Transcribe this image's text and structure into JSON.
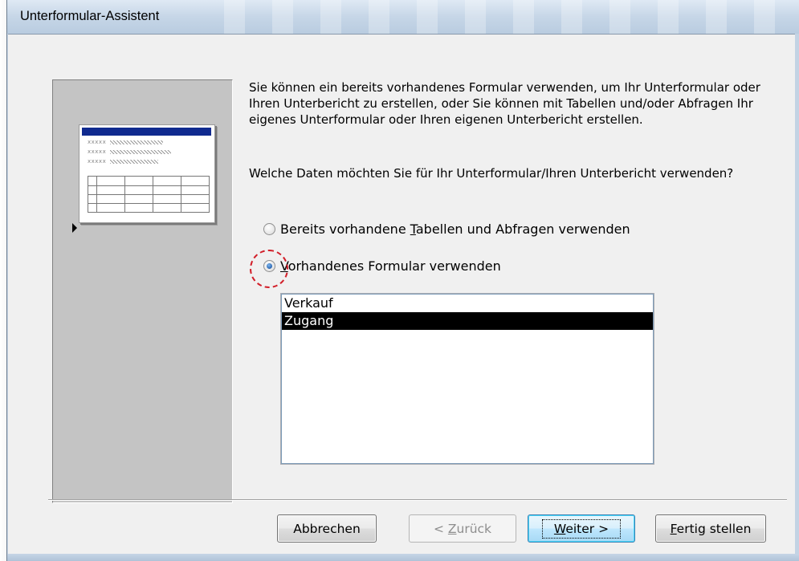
{
  "window": {
    "title": "Unterformular-Assistent"
  },
  "intro_text": "Sie können ein bereits vorhandenes Formular verwenden, um Ihr Unterformular oder Ihren Unterbericht zu erstellen, oder Sie können mit Tabellen und/oder Abfragen Ihr eigenes Unterformular oder Ihren eigenen Unterbericht erstellen.",
  "question_text": "Welche Daten möchten Sie für Ihr Unterformular/Ihren Unterbericht verwenden?",
  "illustration": {
    "placeholder_text": [
      "xxxxx",
      "xxxxx",
      "xxxxx"
    ]
  },
  "options": [
    {
      "label_pre": "Bereits vorhandene ",
      "label_key": "T",
      "label_post": "abellen und Abfragen verwenden",
      "selected": false
    },
    {
      "label_pre": "",
      "label_key": "V",
      "label_post": "orhandenes Formular verwenden",
      "selected": true
    }
  ],
  "forms_list": {
    "items": [
      "Verkauf",
      "Zugang"
    ],
    "selected": "Zugang"
  },
  "buttons": {
    "cancel": {
      "label": "Abbrechen"
    },
    "back": {
      "pre": "< ",
      "key": "Z",
      "post": "urück"
    },
    "next": {
      "pre": "",
      "key": "W",
      "post": "eiter >"
    },
    "finish": {
      "pre": "",
      "key": "F",
      "post": "ertig stellen"
    }
  },
  "colors": {
    "focus_marker": "#d21f2a",
    "list_selection": "#000000",
    "illustration_panel": "#c4c4c4"
  }
}
